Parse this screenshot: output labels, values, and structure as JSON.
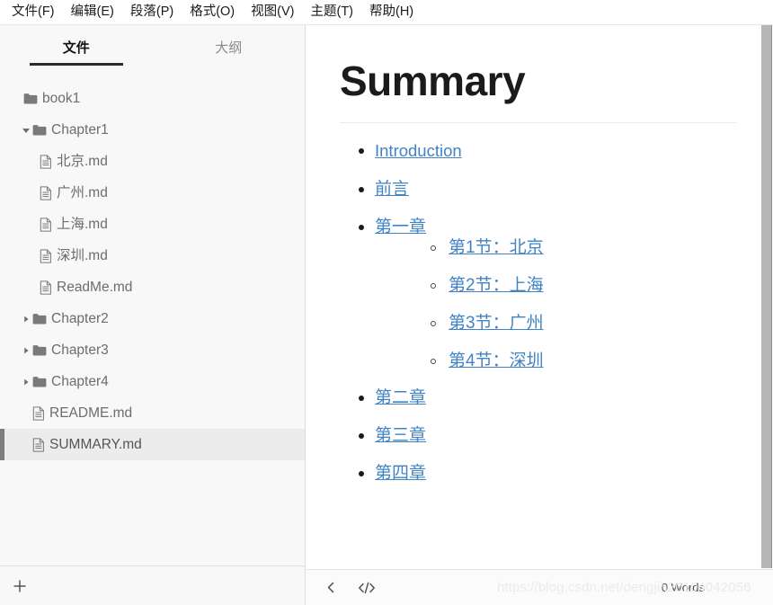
{
  "menubar": {
    "items": [
      {
        "label": "文件(F)",
        "name": "menu-file"
      },
      {
        "label": "编辑(E)",
        "name": "menu-edit"
      },
      {
        "label": "段落(P)",
        "name": "menu-paragraph"
      },
      {
        "label": "格式(O)",
        "name": "menu-format"
      },
      {
        "label": "视图(V)",
        "name": "menu-view"
      },
      {
        "label": "主题(T)",
        "name": "menu-theme"
      },
      {
        "label": "帮助(H)",
        "name": "menu-help"
      }
    ]
  },
  "sidebar": {
    "tabs": [
      {
        "label": "文件",
        "active": true
      },
      {
        "label": "大纲",
        "active": false
      }
    ],
    "tree": [
      {
        "label": "book1",
        "type": "folder",
        "level": 0,
        "twisty": "none",
        "selected": false
      },
      {
        "label": "Chapter1",
        "type": "folder",
        "level": 1,
        "twisty": "expanded",
        "selected": false
      },
      {
        "label": "北京.md",
        "type": "file",
        "level": 2,
        "twisty": "none",
        "selected": false
      },
      {
        "label": "广州.md",
        "type": "file",
        "level": 2,
        "twisty": "none",
        "selected": false
      },
      {
        "label": "上海.md",
        "type": "file",
        "level": 2,
        "twisty": "none",
        "selected": false
      },
      {
        "label": "深圳.md",
        "type": "file",
        "level": 2,
        "twisty": "none",
        "selected": false
      },
      {
        "label": "ReadMe.md",
        "type": "file",
        "level": 2,
        "twisty": "none",
        "selected": false
      },
      {
        "label": "Chapter2",
        "type": "folder",
        "level": 1,
        "twisty": "collapsed",
        "selected": false
      },
      {
        "label": "Chapter3",
        "type": "folder",
        "level": 1,
        "twisty": "collapsed",
        "selected": false
      },
      {
        "label": "Chapter4",
        "type": "folder",
        "level": 1,
        "twisty": "collapsed",
        "selected": false
      },
      {
        "label": "README.md",
        "type": "file",
        "level": 1,
        "twisty": "none",
        "selected": false
      },
      {
        "label": "SUMMARY.md",
        "type": "file",
        "level": 1,
        "twisty": "none",
        "selected": true
      }
    ],
    "footer": {
      "add_label": "+"
    }
  },
  "editor": {
    "title": "Summary",
    "list": [
      {
        "text": "Introduction",
        "level": 1,
        "group": 1
      },
      {
        "text": "前言",
        "level": 1,
        "group": 2
      },
      {
        "text": "第一章",
        "level": 1,
        "group": 2
      },
      {
        "text": "第1节：北京",
        "level": 2,
        "group": 2
      },
      {
        "text": "第2节：上海",
        "level": 2,
        "group": 2
      },
      {
        "text": "第3节：广州",
        "level": 2,
        "group": 2
      },
      {
        "text": "第4节：深圳",
        "level": 2,
        "group": 2
      },
      {
        "text": "第二章",
        "level": 1,
        "group": 2
      },
      {
        "text": "第三章",
        "level": 1,
        "group": 2
      },
      {
        "text": "第四章",
        "level": 1,
        "group": 2
      }
    ]
  },
  "statusbar": {
    "back_icon": "chevron-left-icon",
    "source_icon": "source-code-icon",
    "word_count": "0 Words"
  },
  "watermark": {
    "text": "https://blog.csdn.net/dengjin20104042056"
  },
  "colors": {
    "link": "#4183c4",
    "sidebar_bg": "#f8f8f8",
    "selected_bg": "#ececec",
    "selected_accent": "#7d7d7d",
    "tab_underline": "#2b2b2b",
    "scrollbar": "#b6b6b6"
  }
}
